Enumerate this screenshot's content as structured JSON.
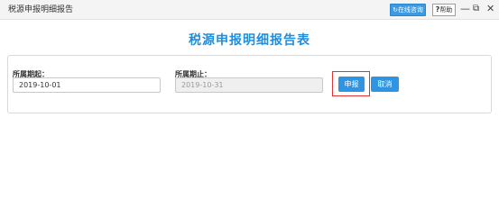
{
  "window": {
    "title": "税源申报明细报告",
    "online_consult": "在线咨询",
    "help_mark": "?",
    "help_label": "帮助",
    "minimize_glyph": "—",
    "maximize_glyph": "⧉",
    "close_glyph": "✕"
  },
  "page": {
    "title": "税源申报明细报告表"
  },
  "form": {
    "period_start_label": "所属期起：",
    "period_start_value": "2019-10-01",
    "period_end_label": "所属期止：",
    "period_end_value": "2019-10-31",
    "submit_label": "申报",
    "cancel_label": "取消"
  },
  "colors": {
    "accent": "#1f8ee0",
    "button": "#2f95e3",
    "highlight": "#e33232"
  },
  "icons": [
    "refresh-icon",
    "minimize-icon",
    "maximize-icon",
    "close-icon"
  ]
}
